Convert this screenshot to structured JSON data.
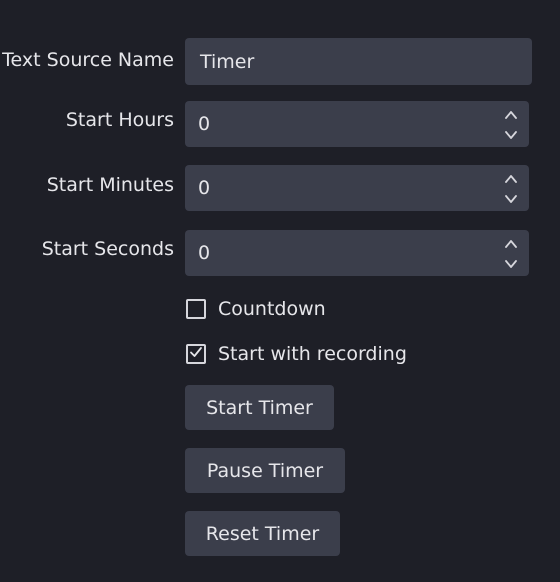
{
  "form": {
    "text_source_name": {
      "label": "Text Source Name",
      "value": "Timer"
    },
    "start_hours": {
      "label": "Start Hours",
      "value": "0"
    },
    "start_minutes": {
      "label": "Start Minutes",
      "value": "0"
    },
    "start_seconds": {
      "label": "Start Seconds",
      "value": "0"
    },
    "countdown": {
      "label": "Countdown",
      "checked": false
    },
    "start_with_recording": {
      "label": "Start with recording",
      "checked": true
    }
  },
  "buttons": {
    "start": "Start Timer",
    "pause": "Pause Timer",
    "reset": "Reset Timer"
  },
  "icons": {
    "spin_up": "chevron-up-icon",
    "spin_down": "chevron-down-icon",
    "check": "checkmark-icon"
  },
  "colors": {
    "background": "#1e1f27",
    "field": "#3b3e4b",
    "text": "#e6e6ea"
  }
}
